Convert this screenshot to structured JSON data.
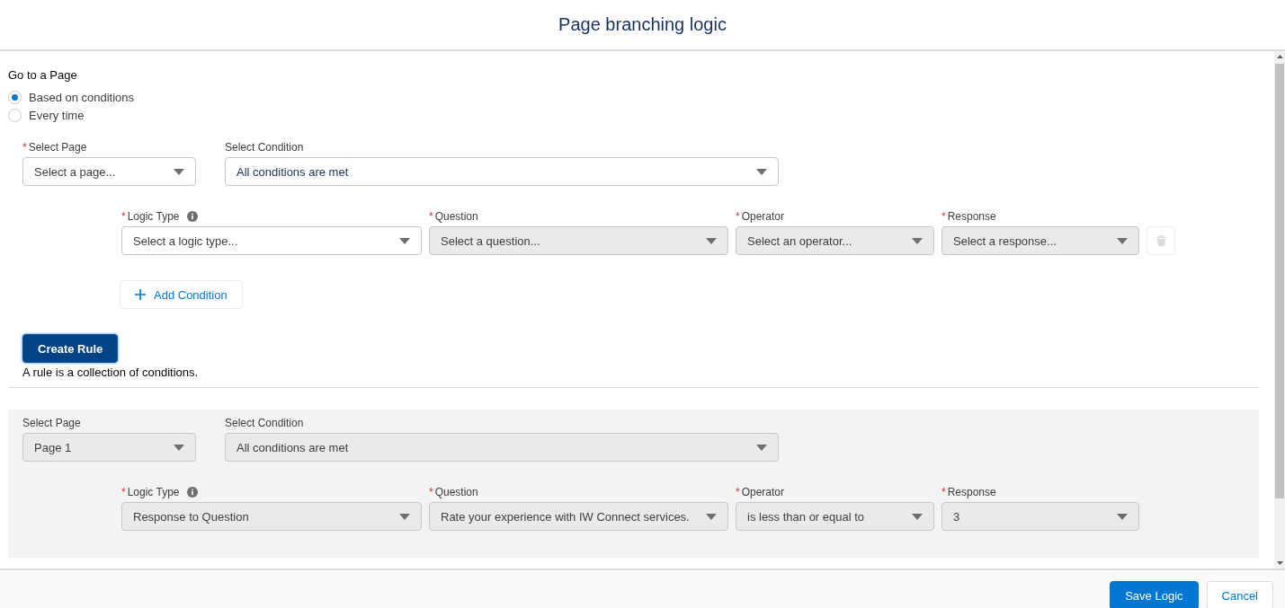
{
  "header": {
    "title": "Page branching logic"
  },
  "section_label": "Go to a Page",
  "radios": [
    {
      "label": "Based on conditions",
      "selected": true
    },
    {
      "label": "Every time",
      "selected": false
    }
  ],
  "new_rule": {
    "fields": [
      {
        "label": "Select Page",
        "required_mark": "*",
        "placeholder": "Select a page...",
        "disabled": false
      },
      {
        "label": "Select Condition",
        "value": "All conditions are met",
        "disabled": false
      }
    ],
    "conditions": [
      {
        "fields": [
          {
            "label": "Logic Type",
            "required_mark": "*",
            "info": true,
            "placeholder": "Select a logic type...",
            "disabled": false
          },
          {
            "label": "Question",
            "required_mark": "*",
            "placeholder": "Select a question...",
            "disabled": true
          },
          {
            "label": "Operator",
            "required_mark": "*",
            "placeholder": "Select an operator...",
            "disabled": true
          },
          {
            "label": "Response",
            "required_mark": "*",
            "placeholder": "Select a response...",
            "disabled": true
          }
        ],
        "delete_disabled": true
      }
    ],
    "add_condition": "Add Condition",
    "create_rule": "Create Rule",
    "hint": "A rule is a collection of conditions."
  },
  "rules": [
    {
      "fields": [
        {
          "label": "Select Page",
          "value": "Page 1",
          "disabled": true
        },
        {
          "label": "Select Condition",
          "value": "All conditions are met",
          "disabled": true
        }
      ],
      "conditions": [
        {
          "fields": [
            {
              "label": "Logic Type",
              "required_mark": "*",
              "info": true,
              "value": "Response to Question",
              "disabled": true
            },
            {
              "label": "Question",
              "required_mark": "*",
              "value": "Rate your experience with IW Connect services.",
              "disabled": true
            },
            {
              "label": "Operator",
              "required_mark": "*",
              "value": "is less than or equal to",
              "disabled": true
            },
            {
              "label": "Response",
              "required_mark": "*",
              "value": "3",
              "disabled": true
            }
          ]
        }
      ]
    }
  ],
  "footer": {
    "save": "Save Logic",
    "cancel": "Cancel"
  }
}
